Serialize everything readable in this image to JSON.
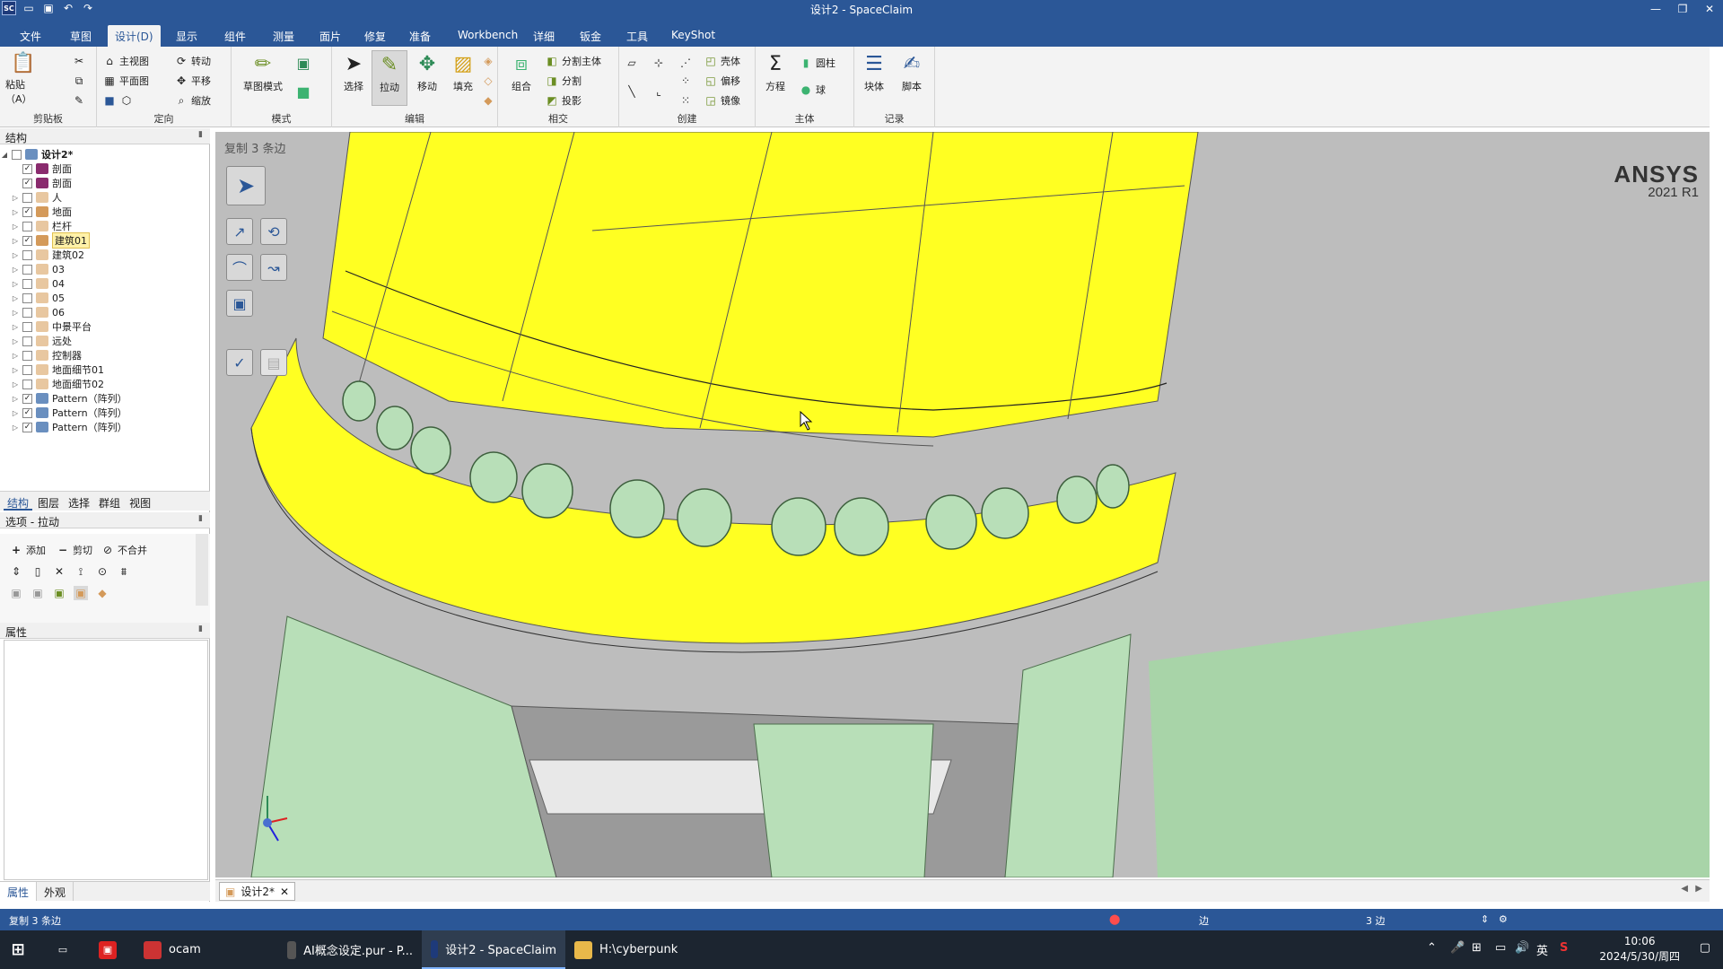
{
  "window": {
    "title": "设计2 - SpaceClaim",
    "app_logo": "SC",
    "qat_icons": [
      "folder-icon",
      "save-icon",
      "undo-icon",
      "redo-icon"
    ]
  },
  "menu": {
    "tabs": [
      "文件",
      "草图",
      "设计(D)",
      "显示",
      "组件",
      "测量",
      "面片",
      "修复",
      "准备",
      "Workbench",
      "详细",
      "钣金",
      "工具",
      "KeyShot"
    ],
    "active_index": 2
  },
  "ribbon": {
    "clipboard": {
      "paste": "粘贴（A）",
      "group": "剪贴板"
    },
    "orient": {
      "home_view": "主视图",
      "plan_view": "平面图",
      "rotate": "转动",
      "pan": "平移",
      "zoom": "缩放",
      "group": "定向"
    },
    "mode": {
      "sketch_mode": "草图模式",
      "group": "模式"
    },
    "edit": {
      "select": "选择",
      "pull": "拉动",
      "move": "移动",
      "fill": "填充",
      "group": "编辑"
    },
    "intersect": {
      "combine": "组合",
      "split_body": "分割主体",
      "split": "分割",
      "project": "投影",
      "group": "相交"
    },
    "create": {
      "shell": "壳体",
      "offset": "偏移",
      "mirror": "镜像",
      "group": "创建"
    },
    "body": {
      "equation": "方程",
      "cylinder": "圆柱",
      "sphere": "球",
      "group": "主体"
    },
    "record": {
      "block": "块体",
      "script": "脚本",
      "group": "记录"
    }
  },
  "structure": {
    "header": "结构",
    "root": "设计2*",
    "items": [
      {
        "label": "剖面",
        "checked": true,
        "color": "#8a2b6e",
        "expandable": false
      },
      {
        "label": "剖面",
        "checked": true,
        "color": "#8a2b6e",
        "expandable": false
      },
      {
        "label": "人",
        "checked": false,
        "color": "#e8c7a0",
        "expandable": true
      },
      {
        "label": "地面",
        "checked": true,
        "color": "#d49a5a",
        "expandable": true
      },
      {
        "label": "栏杆",
        "checked": false,
        "color": "#e8c7a0",
        "expandable": true
      },
      {
        "label": "建筑01",
        "checked": true,
        "color": "#d49a5a",
        "expandable": true,
        "selected": true
      },
      {
        "label": "建筑02",
        "checked": false,
        "color": "#e8c7a0",
        "expandable": true
      },
      {
        "label": "03",
        "checked": false,
        "color": "#e8c7a0",
        "expandable": true
      },
      {
        "label": "04",
        "checked": false,
        "color": "#e8c7a0",
        "expandable": true
      },
      {
        "label": "05",
        "checked": false,
        "color": "#e8c7a0",
        "expandable": true
      },
      {
        "label": "06",
        "checked": false,
        "color": "#e8c7a0",
        "expandable": true
      },
      {
        "label": "中景平台",
        "checked": false,
        "color": "#e8c7a0",
        "expandable": true
      },
      {
        "label": "远处",
        "checked": false,
        "color": "#e8c7a0",
        "expandable": true
      },
      {
        "label": "控制器",
        "checked": false,
        "color": "#e8c7a0",
        "expandable": true
      },
      {
        "label": "地面细节01",
        "checked": false,
        "color": "#e8c7a0",
        "expandable": true
      },
      {
        "label": "地面细节02",
        "checked": false,
        "color": "#e8c7a0",
        "expandable": true
      },
      {
        "label": "Pattern（阵列）",
        "checked": true,
        "color": "#6a8fbf",
        "expandable": true
      },
      {
        "label": "Pattern（阵列）",
        "checked": true,
        "color": "#6a8fbf",
        "expandable": true
      },
      {
        "label": "Pattern（阵列）",
        "checked": true,
        "color": "#6a8fbf",
        "expandable": true
      }
    ]
  },
  "panel_tabs": [
    "结构",
    "图层",
    "选择",
    "群组",
    "视图"
  ],
  "options": {
    "header": "选项 - 拉动",
    "add": "添加",
    "cut": "剪切",
    "no_merge": "不合并"
  },
  "properties": {
    "header": "属性"
  },
  "bottom_tabs": [
    "属性",
    "外观"
  ],
  "viewport": {
    "hint": "复制 3 条边",
    "brand": "ANSYS",
    "version": "2021 R1"
  },
  "doc_tab": {
    "label": "设计2*"
  },
  "status": {
    "message": "复制 3 条边",
    "mode": "边",
    "selection": "3 边"
  },
  "taskbar": {
    "items": [
      {
        "label": "ocam",
        "icon": "ocam"
      },
      {
        "label": "AI概念设定.pur - P...",
        "icon": "paint"
      },
      {
        "label": "设计2 - SpaceClaim",
        "icon": "SC",
        "active": true
      },
      {
        "label": "H:\\cyberpunk",
        "icon": "folder"
      }
    ],
    "ime": "英",
    "time": "10:06",
    "date": "2024/5/30/周四"
  },
  "colors": {
    "accent": "#2b5797",
    "model_yellow": "#ffff22",
    "model_green": "#b8dfb8",
    "ground": "#a8d4a8"
  }
}
